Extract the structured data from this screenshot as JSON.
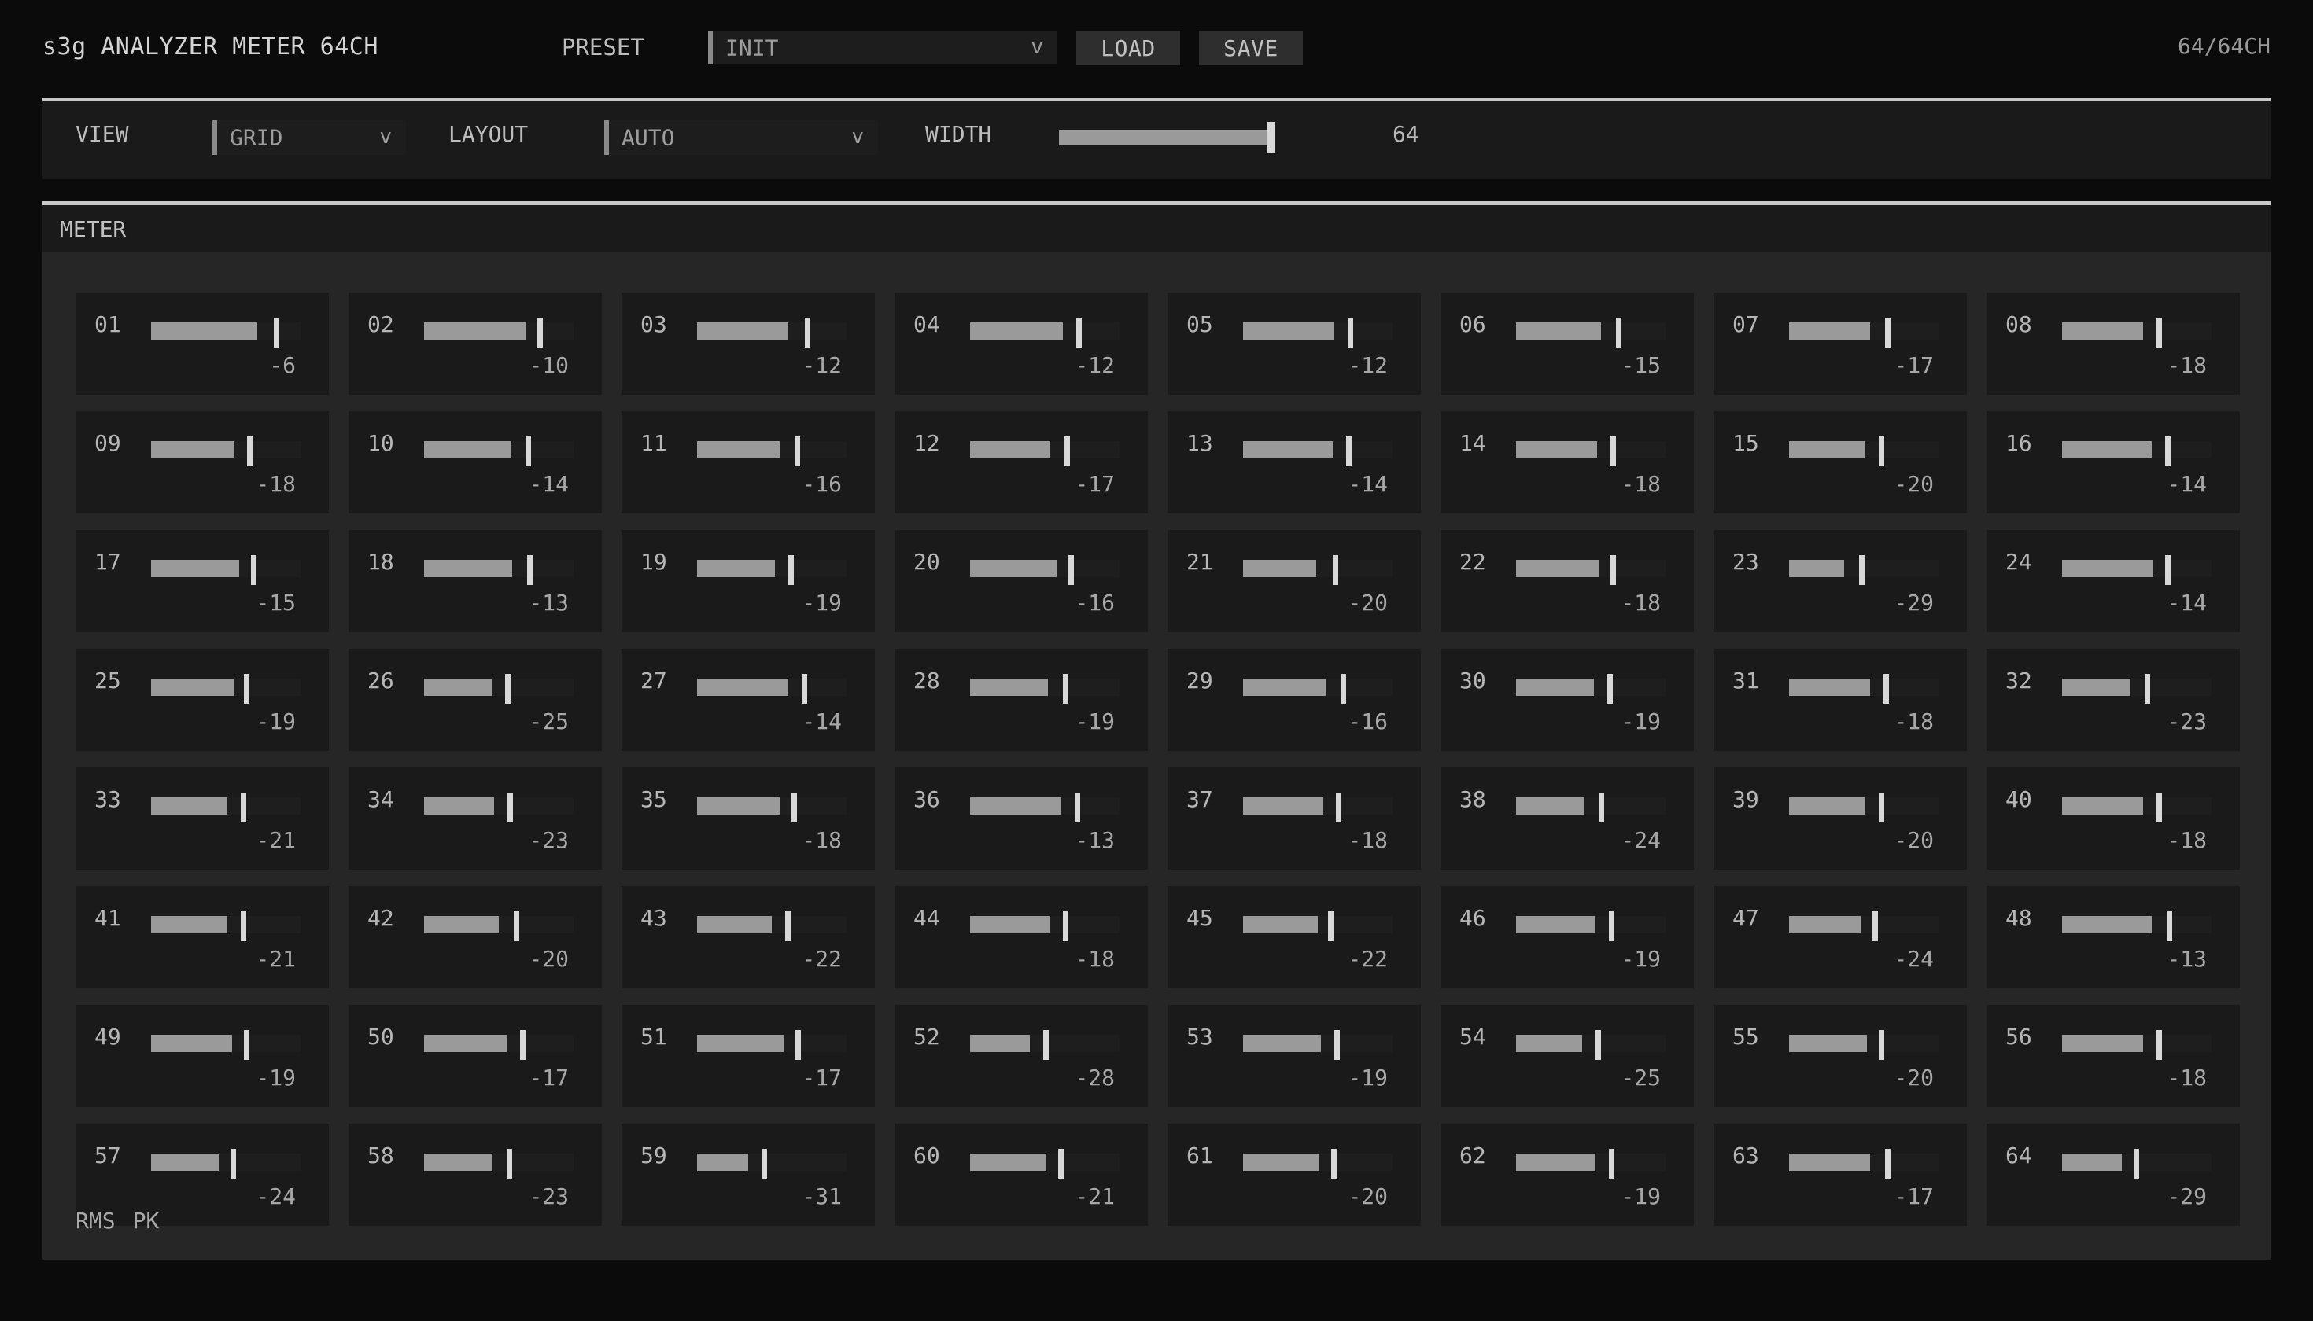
{
  "header": {
    "title": "s3g ANALYZER METER 64CH",
    "preset_label": "PRESET",
    "preset_value": "INIT",
    "dropdown_arrow": "v",
    "load_label": "LOAD",
    "save_label": "SAVE",
    "channel_count": "64/64CH"
  },
  "toolbar": {
    "view_label": "VIEW",
    "view_value": "GRID",
    "layout_label": "LAYOUT",
    "layout_value": "AUTO",
    "width_label": "WIDTH",
    "width_value": "64",
    "width_fraction": 0.98
  },
  "meter": {
    "title": "METER",
    "legend": [
      "RMS",
      "PK"
    ],
    "channels": [
      {
        "num": "01",
        "db": "-6",
        "rms_fraction": 0.71,
        "pk_fraction": 0.82
      },
      {
        "num": "02",
        "db": "-10",
        "rms_fraction": 0.68,
        "pk_fraction": 0.76
      },
      {
        "num": "03",
        "db": "-12",
        "rms_fraction": 0.61,
        "pk_fraction": 0.72
      },
      {
        "num": "04",
        "db": "-12",
        "rms_fraction": 0.62,
        "pk_fraction": 0.71
      },
      {
        "num": "05",
        "db": "-12",
        "rms_fraction": 0.61,
        "pk_fraction": 0.7
      },
      {
        "num": "06",
        "db": "-15",
        "rms_fraction": 0.57,
        "pk_fraction": 0.67
      },
      {
        "num": "07",
        "db": "-17",
        "rms_fraction": 0.54,
        "pk_fraction": 0.64
      },
      {
        "num": "08",
        "db": "-18",
        "rms_fraction": 0.54,
        "pk_fraction": 0.63
      },
      {
        "num": "09",
        "db": "-18",
        "rms_fraction": 0.56,
        "pk_fraction": 0.64
      },
      {
        "num": "10",
        "db": "-14",
        "rms_fraction": 0.58,
        "pk_fraction": 0.68
      },
      {
        "num": "11",
        "db": "-16",
        "rms_fraction": 0.55,
        "pk_fraction": 0.65
      },
      {
        "num": "12",
        "db": "-17",
        "rms_fraction": 0.53,
        "pk_fraction": 0.63
      },
      {
        "num": "13",
        "db": "-14",
        "rms_fraction": 0.6,
        "pk_fraction": 0.69
      },
      {
        "num": "14",
        "db": "-18",
        "rms_fraction": 0.54,
        "pk_fraction": 0.63
      },
      {
        "num": "15",
        "db": "-20",
        "rms_fraction": 0.51,
        "pk_fraction": 0.6
      },
      {
        "num": "16",
        "db": "-14",
        "rms_fraction": 0.6,
        "pk_fraction": 0.69
      },
      {
        "num": "17",
        "db": "-15",
        "rms_fraction": 0.59,
        "pk_fraction": 0.67
      },
      {
        "num": "18",
        "db": "-13",
        "rms_fraction": 0.59,
        "pk_fraction": 0.69
      },
      {
        "num": "19",
        "db": "-19",
        "rms_fraction": 0.52,
        "pk_fraction": 0.61
      },
      {
        "num": "20",
        "db": "-16",
        "rms_fraction": 0.58,
        "pk_fraction": 0.66
      },
      {
        "num": "21",
        "db": "-20",
        "rms_fraction": 0.49,
        "pk_fraction": 0.6
      },
      {
        "num": "22",
        "db": "-18",
        "rms_fraction": 0.55,
        "pk_fraction": 0.63
      },
      {
        "num": "23",
        "db": "-29",
        "rms_fraction": 0.37,
        "pk_fraction": 0.47
      },
      {
        "num": "24",
        "db": "-14",
        "rms_fraction": 0.61,
        "pk_fraction": 0.69
      },
      {
        "num": "25",
        "db": "-19",
        "rms_fraction": 0.55,
        "pk_fraction": 0.62
      },
      {
        "num": "26",
        "db": "-25",
        "rms_fraction": 0.45,
        "pk_fraction": 0.54
      },
      {
        "num": "27",
        "db": "-14",
        "rms_fraction": 0.61,
        "pk_fraction": 0.7
      },
      {
        "num": "28",
        "db": "-19",
        "rms_fraction": 0.52,
        "pk_fraction": 0.62
      },
      {
        "num": "29",
        "db": "-16",
        "rms_fraction": 0.55,
        "pk_fraction": 0.65
      },
      {
        "num": "30",
        "db": "-19",
        "rms_fraction": 0.52,
        "pk_fraction": 0.61
      },
      {
        "num": "31",
        "db": "-18",
        "rms_fraction": 0.54,
        "pk_fraction": 0.63
      },
      {
        "num": "32",
        "db": "-23",
        "rms_fraction": 0.46,
        "pk_fraction": 0.55
      },
      {
        "num": "33",
        "db": "-21",
        "rms_fraction": 0.51,
        "pk_fraction": 0.6
      },
      {
        "num": "34",
        "db": "-23",
        "rms_fraction": 0.47,
        "pk_fraction": 0.56
      },
      {
        "num": "35",
        "db": "-18",
        "rms_fraction": 0.55,
        "pk_fraction": 0.63
      },
      {
        "num": "36",
        "db": "-13",
        "rms_fraction": 0.61,
        "pk_fraction": 0.7
      },
      {
        "num": "37",
        "db": "-18",
        "rms_fraction": 0.53,
        "pk_fraction": 0.62
      },
      {
        "num": "38",
        "db": "-24",
        "rms_fraction": 0.46,
        "pk_fraction": 0.55
      },
      {
        "num": "39",
        "db": "-20",
        "rms_fraction": 0.51,
        "pk_fraction": 0.6
      },
      {
        "num": "40",
        "db": "-18",
        "rms_fraction": 0.54,
        "pk_fraction": 0.63
      },
      {
        "num": "41",
        "db": "-21",
        "rms_fraction": 0.51,
        "pk_fraction": 0.6
      },
      {
        "num": "42",
        "db": "-20",
        "rms_fraction": 0.5,
        "pk_fraction": 0.6
      },
      {
        "num": "43",
        "db": "-22",
        "rms_fraction": 0.5,
        "pk_fraction": 0.59
      },
      {
        "num": "44",
        "db": "-18",
        "rms_fraction": 0.53,
        "pk_fraction": 0.62
      },
      {
        "num": "45",
        "db": "-22",
        "rms_fraction": 0.5,
        "pk_fraction": 0.57
      },
      {
        "num": "46",
        "db": "-19",
        "rms_fraction": 0.53,
        "pk_fraction": 0.62
      },
      {
        "num": "47",
        "db": "-24",
        "rms_fraction": 0.48,
        "pk_fraction": 0.56
      },
      {
        "num": "48",
        "db": "-13",
        "rms_fraction": 0.6,
        "pk_fraction": 0.7
      },
      {
        "num": "49",
        "db": "-19",
        "rms_fraction": 0.54,
        "pk_fraction": 0.62
      },
      {
        "num": "50",
        "db": "-17",
        "rms_fraction": 0.55,
        "pk_fraction": 0.64
      },
      {
        "num": "51",
        "db": "-17",
        "rms_fraction": 0.58,
        "pk_fraction": 0.66
      },
      {
        "num": "52",
        "db": "-28",
        "rms_fraction": 0.4,
        "pk_fraction": 0.49
      },
      {
        "num": "53",
        "db": "-19",
        "rms_fraction": 0.52,
        "pk_fraction": 0.61
      },
      {
        "num": "54",
        "db": "-25",
        "rms_fraction": 0.44,
        "pk_fraction": 0.53
      },
      {
        "num": "55",
        "db": "-20",
        "rms_fraction": 0.52,
        "pk_fraction": 0.6
      },
      {
        "num": "56",
        "db": "-18",
        "rms_fraction": 0.54,
        "pk_fraction": 0.63
      },
      {
        "num": "57",
        "db": "-24",
        "rms_fraction": 0.45,
        "pk_fraction": 0.53
      },
      {
        "num": "58",
        "db": "-23",
        "rms_fraction": 0.46,
        "pk_fraction": 0.55
      },
      {
        "num": "59",
        "db": "-31",
        "rms_fraction": 0.34,
        "pk_fraction": 0.43
      },
      {
        "num": "60",
        "db": "-21",
        "rms_fraction": 0.51,
        "pk_fraction": 0.59
      },
      {
        "num": "61",
        "db": "-20",
        "rms_fraction": 0.51,
        "pk_fraction": 0.59
      },
      {
        "num": "62",
        "db": "-19",
        "rms_fraction": 0.53,
        "pk_fraction": 0.62
      },
      {
        "num": "63",
        "db": "-17",
        "rms_fraction": 0.54,
        "pk_fraction": 0.64
      },
      {
        "num": "64",
        "db": "-29",
        "rms_fraction": 0.4,
        "pk_fraction": 0.48
      }
    ]
  }
}
